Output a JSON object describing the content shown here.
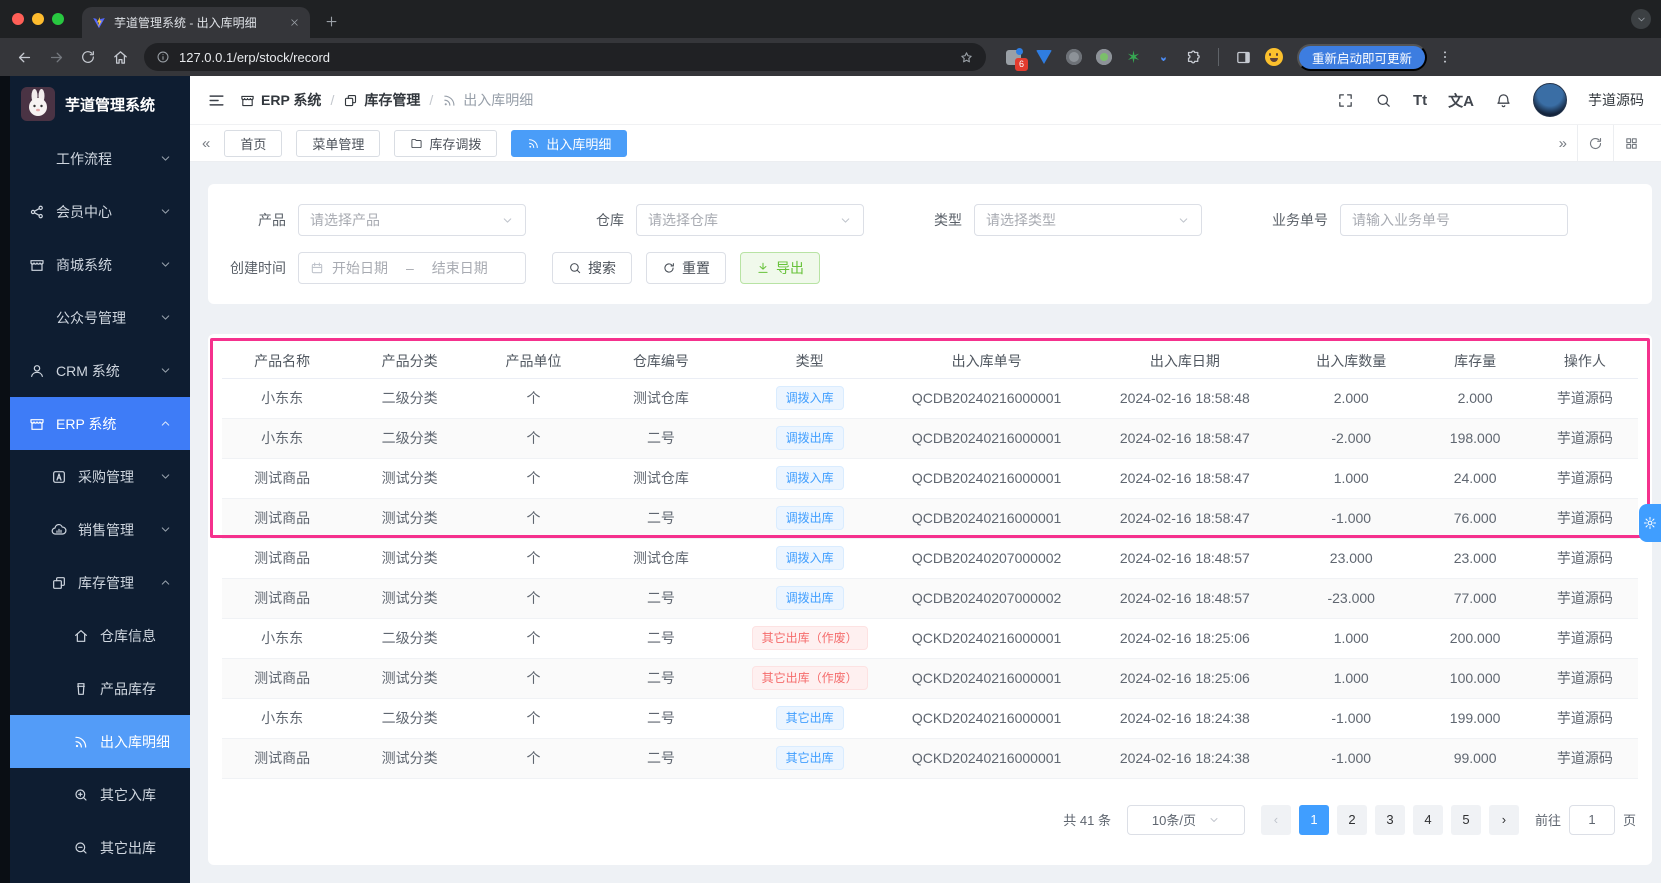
{
  "browser": {
    "tab_title": "芋道管理系统 - 出入库明细",
    "url": "127.0.0.1/erp/stock/record",
    "ext_badge": "6",
    "update_label": "重新启动即可更新"
  },
  "sidebar": {
    "title": "芋道管理系统",
    "items": [
      {
        "label": "工作流程",
        "icon": null,
        "chevron": "down",
        "level": 1,
        "active": false
      },
      {
        "label": "会员中心",
        "icon": "share",
        "chevron": "down",
        "level": 1,
        "active": false
      },
      {
        "label": "商城系统",
        "icon": "store",
        "chevron": "down",
        "level": 1,
        "active": false
      },
      {
        "label": "公众号管理",
        "icon": null,
        "chevron": "down",
        "level": 1,
        "active": false
      },
      {
        "label": "CRM 系统",
        "icon": "user",
        "chevron": "down",
        "level": 1,
        "active": false
      },
      {
        "label": "ERP 系统",
        "icon": "store",
        "chevron": "up",
        "level": 1,
        "active": true
      },
      {
        "label": "采购管理",
        "icon": "boxA",
        "chevron": "down",
        "level": 2,
        "active": false
      },
      {
        "label": "销售管理",
        "icon": "cloud",
        "chevron": "down",
        "level": 2,
        "active": false
      },
      {
        "label": "库存管理",
        "icon": "squares",
        "chevron": "up",
        "level": 2,
        "active": false
      },
      {
        "label": "仓库信息",
        "icon": "home",
        "chevron": null,
        "level": 3,
        "active": false
      },
      {
        "label": "产品库存",
        "icon": "cup",
        "chevron": null,
        "level": 3,
        "active": false
      },
      {
        "label": "出入库明细",
        "icon": "signal",
        "chevron": null,
        "level": 3,
        "active": true
      },
      {
        "label": "其它入库",
        "icon": "zoomIn",
        "chevron": null,
        "level": 3,
        "active": false
      },
      {
        "label": "其它出库",
        "icon": "zoomOut",
        "chevron": null,
        "level": 3,
        "active": false
      }
    ]
  },
  "header": {
    "breadcrumb": [
      {
        "label": "ERP 系统",
        "icon": "store"
      },
      {
        "label": "库存管理",
        "icon": "squares"
      },
      {
        "label": "出入库明细",
        "icon": "signal"
      }
    ],
    "font_glyph": "Tt",
    "translate_glyph": "文A",
    "user_name": "芋道源码"
  },
  "tags_nav": {
    "left": "«",
    "right": "»",
    "tabs": [
      {
        "label": "首页",
        "icon": null,
        "active": false
      },
      {
        "label": "菜单管理",
        "icon": null,
        "active": false
      },
      {
        "label": "库存调拨",
        "icon": "folder",
        "active": false
      },
      {
        "label": "出入库明细",
        "icon": "signal",
        "active": true
      }
    ]
  },
  "filters": {
    "product_label": "产品",
    "product_placeholder": "请选择产品",
    "warehouse_label": "仓库",
    "warehouse_placeholder": "请选择仓库",
    "type_label": "类型",
    "type_placeholder": "请选择类型",
    "bizno_label": "业务单号",
    "bizno_placeholder": "请输入业务单号",
    "created_label": "创建时间",
    "date_start": "开始日期",
    "date_sep": "–",
    "date_end": "结束日期",
    "search_label": "搜索",
    "reset_label": "重置",
    "export_label": "导出"
  },
  "table": {
    "columns": [
      "产品名称",
      "产品分类",
      "产品单位",
      "仓库编号",
      "类型",
      "出入库单号",
      "出入库日期",
      "出入库数量",
      "库存量",
      "操作人"
    ],
    "rows": [
      {
        "product": "小东东",
        "category": "二级分类",
        "unit": "个",
        "warehouse": "测试仓库",
        "type": {
          "label": "调拨入库",
          "color": "blue"
        },
        "order": "QCDB20240216000001",
        "date": "2024-02-16 18:58:48",
        "qty": "2.000",
        "stock": "2.000",
        "operator": "芋道源码"
      },
      {
        "product": "小东东",
        "category": "二级分类",
        "unit": "个",
        "warehouse": "二号",
        "type": {
          "label": "调拨出库",
          "color": "blue"
        },
        "order": "QCDB20240216000001",
        "date": "2024-02-16 18:58:47",
        "qty": "-2.000",
        "stock": "198.000",
        "operator": "芋道源码"
      },
      {
        "product": "测试商品",
        "category": "测试分类",
        "unit": "个",
        "warehouse": "测试仓库",
        "type": {
          "label": "调拨入库",
          "color": "blue"
        },
        "order": "QCDB20240216000001",
        "date": "2024-02-16 18:58:47",
        "qty": "1.000",
        "stock": "24.000",
        "operator": "芋道源码"
      },
      {
        "product": "测试商品",
        "category": "测试分类",
        "unit": "个",
        "warehouse": "二号",
        "type": {
          "label": "调拨出库",
          "color": "blue"
        },
        "order": "QCDB20240216000001",
        "date": "2024-02-16 18:58:47",
        "qty": "-1.000",
        "stock": "76.000",
        "operator": "芋道源码"
      },
      {
        "product": "测试商品",
        "category": "测试分类",
        "unit": "个",
        "warehouse": "测试仓库",
        "type": {
          "label": "调拨入库",
          "color": "blue"
        },
        "order": "QCDB20240207000002",
        "date": "2024-02-16 18:48:57",
        "qty": "23.000",
        "stock": "23.000",
        "operator": "芋道源码"
      },
      {
        "product": "测试商品",
        "category": "测试分类",
        "unit": "个",
        "warehouse": "二号",
        "type": {
          "label": "调拨出库",
          "color": "blue"
        },
        "order": "QCDB20240207000002",
        "date": "2024-02-16 18:48:57",
        "qty": "-23.000",
        "stock": "77.000",
        "operator": "芋道源码"
      },
      {
        "product": "小东东",
        "category": "二级分类",
        "unit": "个",
        "warehouse": "二号",
        "type": {
          "label": "其它出库（作废）",
          "color": "red"
        },
        "order": "QCKD20240216000001",
        "date": "2024-02-16 18:25:06",
        "qty": "1.000",
        "stock": "200.000",
        "operator": "芋道源码"
      },
      {
        "product": "测试商品",
        "category": "测试分类",
        "unit": "个",
        "warehouse": "二号",
        "type": {
          "label": "其它出库（作废）",
          "color": "red"
        },
        "order": "QCKD20240216000001",
        "date": "2024-02-16 18:25:06",
        "qty": "1.000",
        "stock": "100.000",
        "operator": "芋道源码"
      },
      {
        "product": "小东东",
        "category": "二级分类",
        "unit": "个",
        "warehouse": "二号",
        "type": {
          "label": "其它出库",
          "color": "blue"
        },
        "order": "QCKD20240216000001",
        "date": "2024-02-16 18:24:38",
        "qty": "-1.000",
        "stock": "199.000",
        "operator": "芋道源码"
      },
      {
        "product": "测试商品",
        "category": "测试分类",
        "unit": "个",
        "warehouse": "二号",
        "type": {
          "label": "其它出库",
          "color": "blue"
        },
        "order": "QCKD20240216000001",
        "date": "2024-02-16 18:24:38",
        "qty": "-1.000",
        "stock": "99.000",
        "operator": "芋道源码"
      }
    ]
  },
  "pagination": {
    "total": "共 41 条",
    "size": "10条/页",
    "prev_icon": "‹",
    "next_icon": "›",
    "pages": [
      "1",
      "2",
      "3",
      "4",
      "5"
    ],
    "current": "1",
    "goto_label": "前往",
    "goto_value": "1",
    "unit_label": "页"
  },
  "colors": {
    "accent": "#409eff",
    "debug_highlight": "#f5318d",
    "badge_blue": "#409eff",
    "badge_red": "#f56c6c",
    "export_green": "#67c23a",
    "sidebar_bg": "#0e1d31"
  }
}
